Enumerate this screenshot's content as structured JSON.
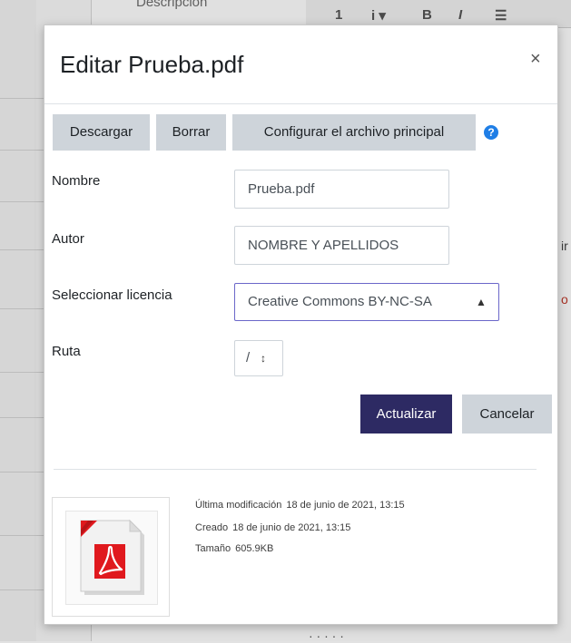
{
  "background": {
    "description_text": "Descripción",
    "toolbar_items": [
      "1",
      "i ▾",
      "B",
      "I",
      "☰"
    ],
    "right_texts": [
      "ir",
      "o"
    ]
  },
  "dialog": {
    "title": "Editar Prueba.pdf",
    "close_label": "×",
    "buttons": {
      "download": "Descargar",
      "delete": "Borrar",
      "set_main": "Configurar el archivo principal",
      "help": "?"
    },
    "form": {
      "name_label": "Nombre",
      "name_value": "Prueba.pdf",
      "author_label": "Autor",
      "author_value": "NOMBRE Y APELLIDOS",
      "license_label": "Seleccionar licencia",
      "license_value": "Creative Commons BY-NC-SA",
      "path_label": "Ruta",
      "path_value": "/"
    },
    "actions": {
      "update": "Actualizar",
      "cancel": "Cancelar"
    },
    "file_info": {
      "modified_label": "Última modificación",
      "modified_value": "18 de junio de 2021, 13:15",
      "created_label": "Creado",
      "created_value": "18 de junio de 2021, 13:15",
      "size_label": "Tamaño",
      "size_value": "605.9KB",
      "icon": "pdf-file-icon"
    }
  },
  "colors": {
    "primary": "#2d2a63",
    "secondary": "#ced4da",
    "help": "#1f7ee6",
    "focus_border": "#6b67c9",
    "pdf_red": "#e0191e"
  }
}
